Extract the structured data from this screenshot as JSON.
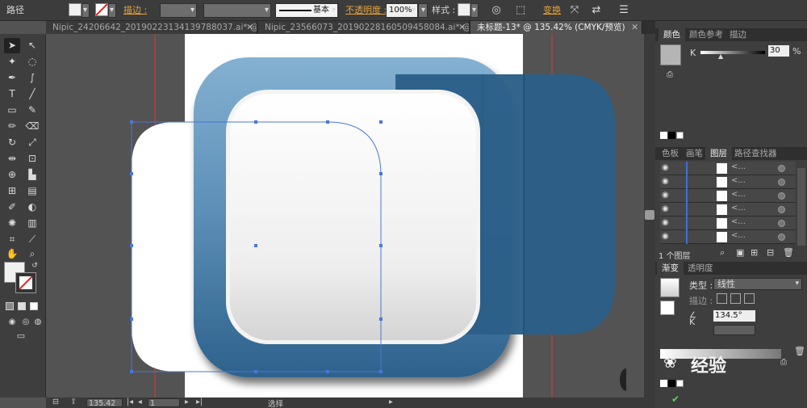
{
  "control_bar": {
    "path_label": "路径",
    "stroke_label": "描边 :",
    "stroke_style": "基本",
    "opacity_label": "不透明度 :",
    "opacity_value": "100%",
    "style_label": "样式 :",
    "transform_label": "变换"
  },
  "tabs": [
    {
      "label": "Nipic_24206642_20190223134139788037.ai* @ 50...",
      "active": false
    },
    {
      "label": "Nipic_23566073_20190228160509458084.ai* @ 98...",
      "active": false
    },
    {
      "label": "未标题-13* @ 135.42% (CMYK/预览)",
      "active": true
    }
  ],
  "color_panel": {
    "tabs": [
      "颜色",
      "颜色参考",
      "描边"
    ],
    "channel": "K",
    "value": "30",
    "unit": "%"
  },
  "layers_panel": {
    "tabs": [
      "色板",
      "画笔",
      "图层",
      "路径查找器"
    ],
    "row_name": "<...",
    "rows": 6,
    "footer": "1 个图层"
  },
  "gradient_panel": {
    "tabs": [
      "渐变",
      "透明度"
    ],
    "type_label": "类型 :",
    "type_value": "线性",
    "stroke_label": "描边 :",
    "angle_value": "134.5°",
    "k_label": "K"
  },
  "status_bar": {
    "zoom": "135.42",
    "page": "1",
    "tool_label": "选择"
  },
  "watermark": {
    "text": "经验"
  },
  "colors": {
    "accent_blue": "#2b5f88",
    "light_blue": "#7aa9cb",
    "selection": "#4a78d6",
    "link_orange": "#e6a23c"
  }
}
